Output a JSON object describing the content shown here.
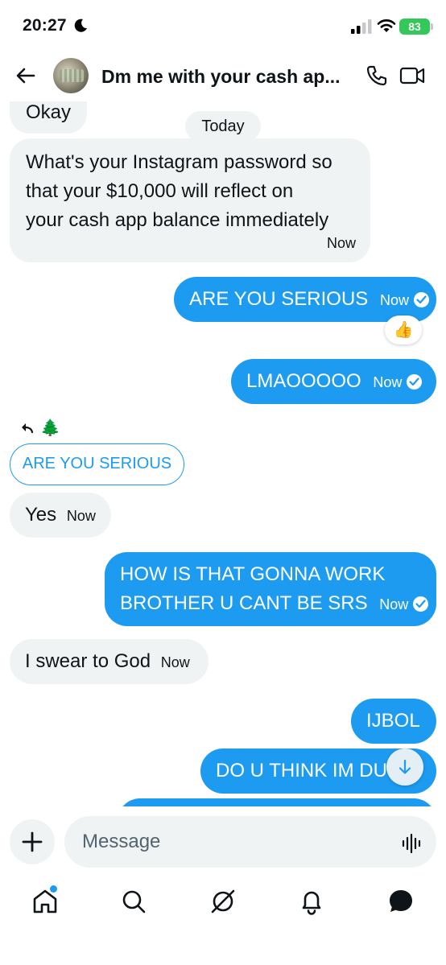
{
  "status_bar": {
    "time": "20:27",
    "battery": "83"
  },
  "header": {
    "title": "Dm me with your cash ap..."
  },
  "messages": {
    "date_divider": "Today",
    "items": [
      {
        "dir": "in",
        "text": "Okay",
        "time": ""
      },
      {
        "dir": "in",
        "lines": [
          "What's your Instagram password so",
          "that your $10,000 will reflect on",
          "your cash app balance immediately"
        ],
        "time": "Now"
      },
      {
        "dir": "out",
        "text": "ARE YOU SERIOUS",
        "time": "Now"
      },
      {
        "dir": "out",
        "text": "LMAOOOOO",
        "time": "Now"
      },
      {
        "dir": "in",
        "text": "Yes",
        "time": "Now"
      },
      {
        "dir": "out",
        "lines": [
          "HOW IS THAT GONNA WORK",
          "BROTHER U CANT BE SRS"
        ],
        "time": "Now"
      },
      {
        "dir": "in",
        "text": "I swear to God",
        "time": "Now"
      },
      {
        "dir": "out",
        "text": "IJBOL",
        "time": ""
      },
      {
        "dir": "out",
        "text": "DO U THINK IM DU",
        "time": ""
      }
    ],
    "reaction": "👍",
    "reply_marker_emoji": "🌲",
    "reply_quote": "ARE YOU SERIOUS"
  },
  "composer": {
    "placeholder": "Message"
  },
  "icons": {
    "header": [
      "back-arrow-icon",
      "phone-icon",
      "video-icon"
    ],
    "nav": [
      "home-icon",
      "search-icon",
      "grok-icon",
      "notifications-icon",
      "messages-icon"
    ],
    "accent": "#1d9bf0"
  }
}
